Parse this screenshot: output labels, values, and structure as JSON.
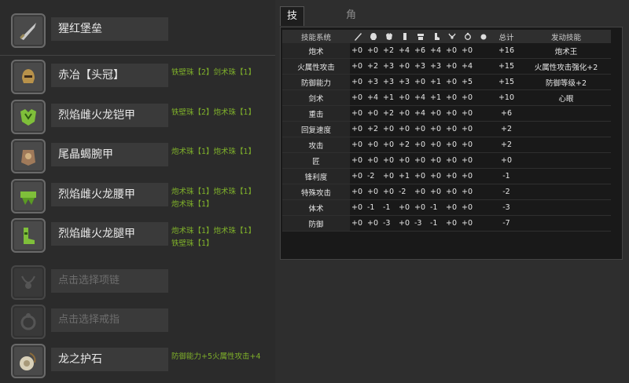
{
  "equipment": [
    {
      "name": "猩红堡垒",
      "decorations": [],
      "icon": "weapon-icon",
      "empty": false
    },
    {
      "name": "赤冶【头冠】",
      "decorations": [
        "铁壁珠【2】剑术珠【1】"
      ],
      "icon": "helmet-icon",
      "empty": false
    },
    {
      "name": "烈焰雌火龙铠甲",
      "decorations": [
        "铁壁珠【2】炮术珠【1】"
      ],
      "icon": "chest-armor-icon",
      "empty": false
    },
    {
      "name": "尾晶蝎腕甲",
      "decorations": [
        "炮术珠【1】炮术珠【1】"
      ],
      "icon": "arm-armor-icon",
      "empty": false
    },
    {
      "name": "烈焰雌火龙腰甲",
      "decorations": [
        "炮术珠【1】炮术珠【1】",
        "炮术珠【1】"
      ],
      "icon": "waist-armor-icon",
      "empty": false
    },
    {
      "name": "烈焰雌火龙腿甲",
      "decorations": [
        "炮术珠【1】炮术珠【1】",
        "铁壁珠【1】"
      ],
      "icon": "leg-armor-icon",
      "empty": false
    },
    {
      "name": "点击选择项链",
      "decorations": [],
      "icon": "necklace-icon",
      "empty": true
    },
    {
      "name": "点击选择戒指",
      "decorations": [],
      "icon": "ring-icon",
      "empty": true
    },
    {
      "name": "龙之护石",
      "decorations": [
        "防御能力+5火属性攻击+4"
      ],
      "icon": "talisman-icon",
      "empty": false
    }
  ],
  "tabs": {
    "active": "技能详情",
    "inactive": "角色信息"
  },
  "table": {
    "header": {
      "skill": "技能系统",
      "total": "总计",
      "activated": "发动技能"
    },
    "column_icons": [
      "weapon-icon",
      "helmet-icon",
      "chest-icon",
      "arm-icon",
      "waist-icon",
      "leg-icon",
      "necklace-icon",
      "ring-icon",
      "talisman-icon"
    ],
    "rows": [
      {
        "skill": "炮术",
        "vals": [
          "+0",
          "+0",
          "+2",
          "+4",
          "+6",
          "+4",
          "+0",
          "+0"
        ],
        "total": "+16",
        "activated": "炮术王"
      },
      {
        "skill": "火属性攻击",
        "vals": [
          "+0",
          "+2",
          "+3",
          "+0",
          "+3",
          "+3",
          "+0",
          "+4"
        ],
        "total": "+15",
        "activated": "火属性攻击强化+2"
      },
      {
        "skill": "防御能力",
        "vals": [
          "+0",
          "+3",
          "+3",
          "+3",
          "+0",
          "+1",
          "+0",
          "+5"
        ],
        "total": "+15",
        "activated": "防御等级+2"
      },
      {
        "skill": "剑术",
        "vals": [
          "+0",
          "+4",
          "+1",
          "+0",
          "+4",
          "+1",
          "+0",
          "+0"
        ],
        "total": "+10",
        "activated": "心眼"
      },
      {
        "skill": "重击",
        "vals": [
          "+0",
          "+0",
          "+2",
          "+0",
          "+4",
          "+0",
          "+0",
          "+0"
        ],
        "total": "+6",
        "activated": ""
      },
      {
        "skill": "回复速度",
        "vals": [
          "+0",
          "+2",
          "+0",
          "+0",
          "+0",
          "+0",
          "+0",
          "+0"
        ],
        "total": "+2",
        "activated": ""
      },
      {
        "skill": "攻击",
        "vals": [
          "+0",
          "+0",
          "+0",
          "+2",
          "+0",
          "+0",
          "+0",
          "+0"
        ],
        "total": "+2",
        "activated": ""
      },
      {
        "skill": "匠",
        "vals": [
          "+0",
          "+0",
          "+0",
          "+0",
          "+0",
          "+0",
          "+0",
          "+0"
        ],
        "total": "+0",
        "activated": ""
      },
      {
        "skill": "锋利度",
        "vals": [
          "+0",
          "-2",
          "+0",
          "+1",
          "+0",
          "+0",
          "+0",
          "+0"
        ],
        "total": "-1",
        "activated": ""
      },
      {
        "skill": "特殊攻击",
        "vals": [
          "+0",
          "+0",
          "+0",
          "-2",
          "+0",
          "+0",
          "+0",
          "+0"
        ],
        "total": "-2",
        "activated": ""
      },
      {
        "skill": "体术",
        "vals": [
          "+0",
          "-1",
          "-1",
          "+0",
          "+0",
          "-1",
          "+0",
          "+0"
        ],
        "total": "-3",
        "activated": ""
      },
      {
        "skill": "防御",
        "vals": [
          "+0",
          "+0",
          "-3",
          "+0",
          "-3",
          "-1",
          "+0",
          "+0"
        ],
        "total": "-7",
        "activated": ""
      }
    ]
  },
  "colors": {
    "decoration_text": "#7fb02a",
    "panel_bg": "#191919",
    "page_bg": "#2e2e2e"
  }
}
